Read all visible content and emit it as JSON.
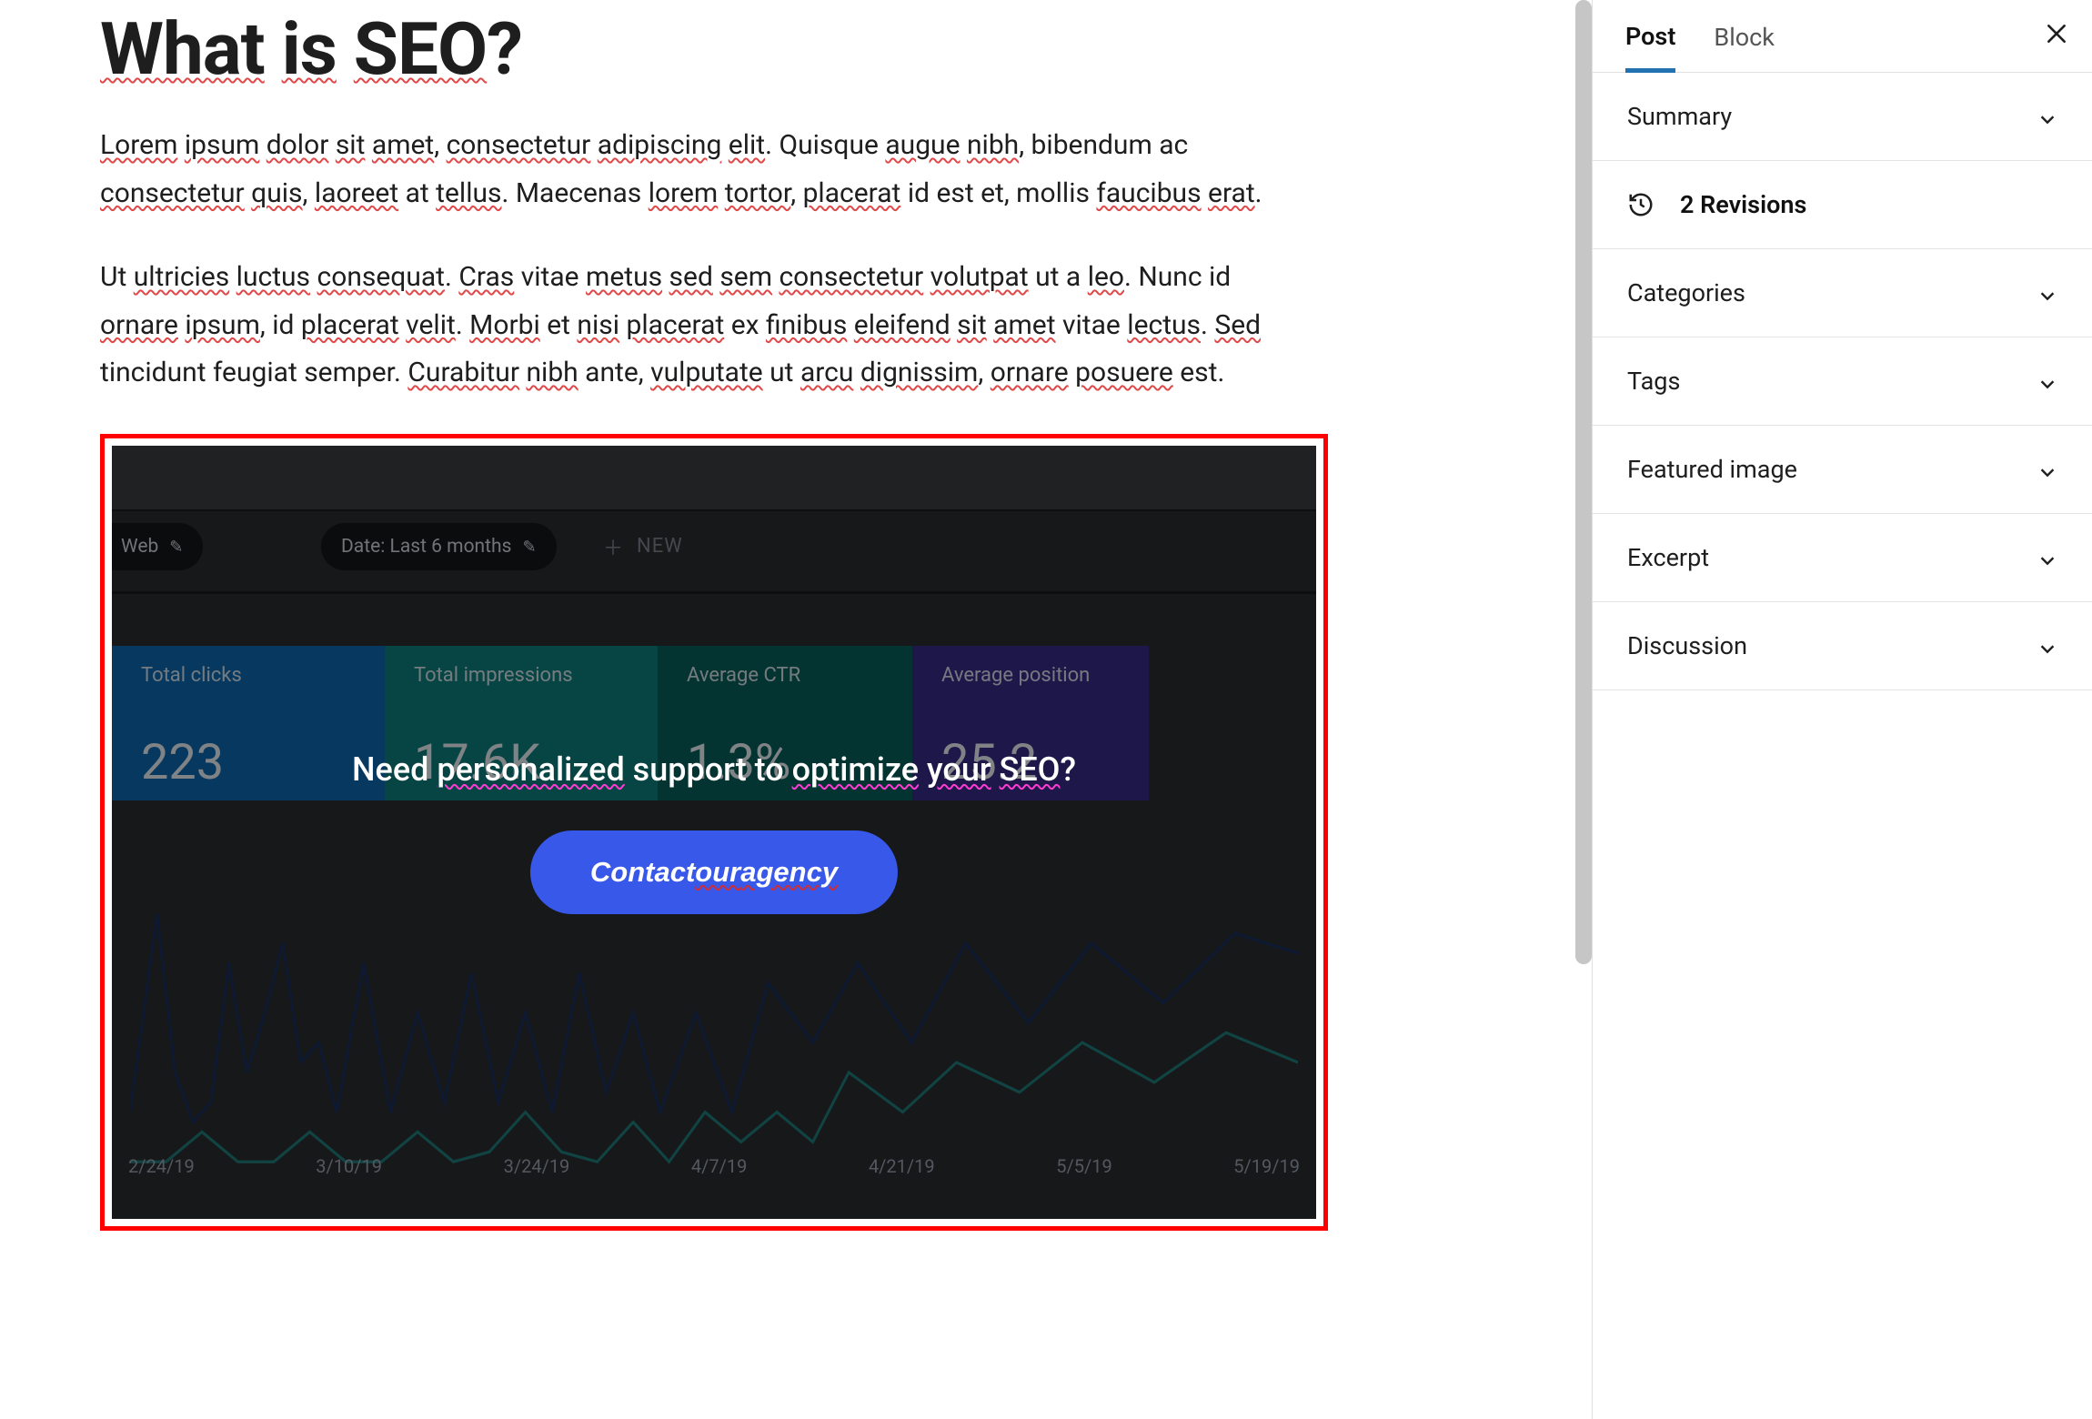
{
  "editor": {
    "title": "What is SEO?",
    "title_spell_spans": [
      "What",
      "is",
      "SEO"
    ],
    "para1": "Lorem ipsum dolor sit amet, consectetur adipiscing elit. Quisque augue nibh, bibendum ac consectetur quis, laoreet at tellus. Maecenas lorem tortor, placerat id est et, mollis faucibus erat.",
    "para2": "Ut ultricies luctus consequat. Cras vitae metus sed sem consectetur volutpat ut a leo. Nunc id ornare ipsum, id placerat velit. Morbi et nisi placerat ex finibus eleifend sit amet vitae lectus. Sed tincidunt feugiat semper. Curabitur nibh ante, vulputate ut arcu dignissim, ornare posuere est."
  },
  "cover_block": {
    "heading": "Need personalized support to optimize your SEO?",
    "button_label": "Contact our agency",
    "bg_chips": {
      "web": "Web",
      "date": "Date: Last 6 months",
      "new": "NEW"
    },
    "bg_stats": {
      "clicks_label": "Total clicks",
      "clicks_value": "223",
      "impr_label": "Total impressions",
      "impr_value": "17.6K",
      "ctr_label": "Average CTR",
      "ctr_value": "1.3%",
      "pos_label": "Average position",
      "pos_value": "25.2"
    },
    "bg_x_legend": [
      "2/24/19",
      "3/10/19",
      "3/24/19",
      "4/7/19",
      "4/21/19",
      "5/5/19",
      "5/19/19"
    ]
  },
  "sidebar": {
    "tabs": {
      "post": "Post",
      "block": "Block"
    },
    "panels": {
      "summary": "Summary",
      "revisions": "2 Revisions",
      "categories": "Categories",
      "tags": "Tags",
      "featured_image": "Featured image",
      "excerpt": "Excerpt",
      "discussion": "Discussion"
    }
  }
}
